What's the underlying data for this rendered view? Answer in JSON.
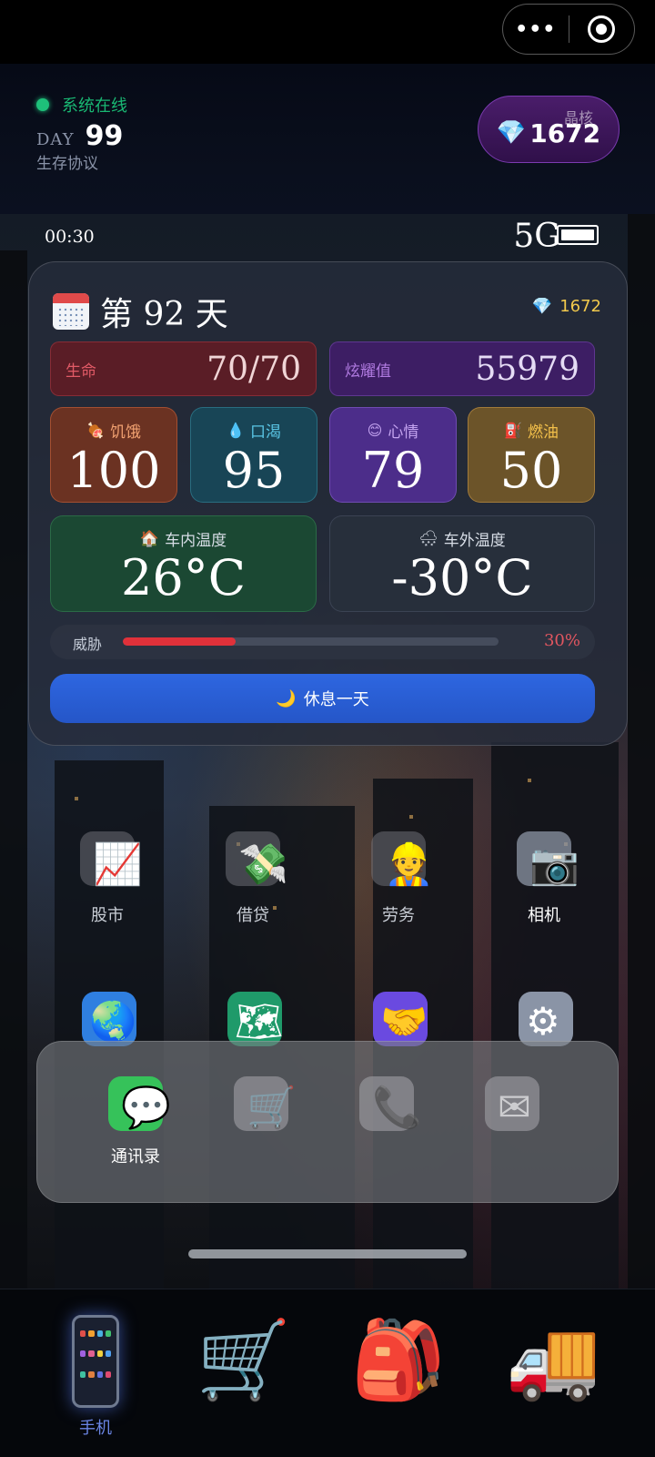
{
  "header": {
    "online_text": "系统在线",
    "day_label": "DAY",
    "day_value": "99",
    "subtitle": "生存协议",
    "crystal_label": "晶核",
    "crystal_value": "1672",
    "capsule_more": "•••"
  },
  "statusbar": {
    "time": "00:30",
    "network": "5G"
  },
  "widget": {
    "title": "第 92 天",
    "gems": "1672",
    "life": {
      "label": "生命",
      "value": "70/70"
    },
    "fame": {
      "label": "炫耀值",
      "value": "55979"
    },
    "stats": [
      {
        "label": "饥饿",
        "icon": "🍖",
        "value": "100"
      },
      {
        "label": "口渴",
        "icon": "💧",
        "value": "95"
      },
      {
        "label": "心情",
        "icon": "😊",
        "value": "79"
      },
      {
        "label": "燃油",
        "icon": "⛽",
        "value": "50"
      }
    ],
    "temp_in": {
      "label": "车内温度",
      "icon": "🏠",
      "value": "26°C"
    },
    "temp_out": {
      "label": "车外温度",
      "icon": "🌨",
      "value": "-30°C"
    },
    "threat": {
      "label": "威胁",
      "value": 0.3,
      "pct_text": "30%"
    },
    "rest_button": {
      "label": "休息一天",
      "icon": "🌙"
    }
  },
  "apps_row1": [
    {
      "name": "股市",
      "icon": "📈"
    },
    {
      "name": "借贷",
      "icon": "💸"
    },
    {
      "name": "劳务",
      "icon": "👷"
    },
    {
      "name": "相机",
      "icon": "📷"
    }
  ],
  "apps_row2_icons": [
    "🌏",
    "🗺",
    "🤝",
    "⚙"
  ],
  "dock": [
    {
      "name": "通讯录",
      "icon": "💬"
    },
    {
      "name": "",
      "icon": "🛒"
    },
    {
      "name": "",
      "icon": "📞"
    },
    {
      "name": "",
      "icon": "✉"
    }
  ],
  "tabbar": [
    {
      "name": "手机",
      "icon": "phone"
    },
    {
      "name": "",
      "icon": "🛒"
    },
    {
      "name": "",
      "icon": "🎒"
    },
    {
      "name": "",
      "icon": "🚚"
    }
  ],
  "colors": {
    "accent": "#2e66e0",
    "threat": "#e0313a",
    "online": "#1ec07a",
    "gem": "#f2c94c"
  }
}
